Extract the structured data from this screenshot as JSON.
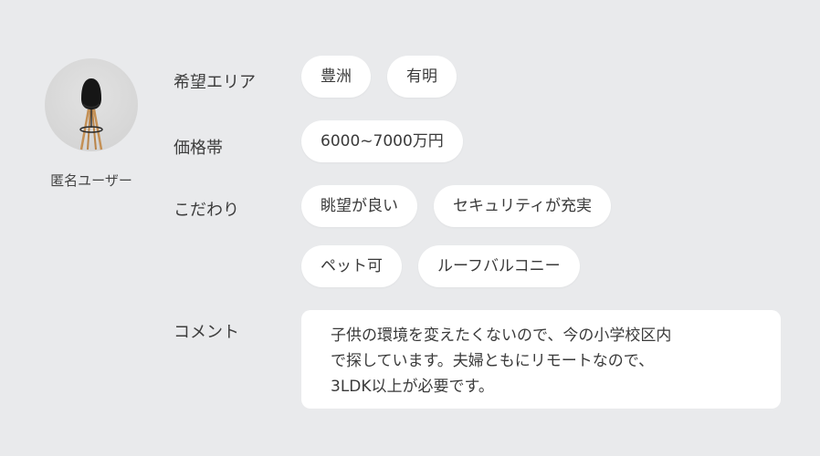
{
  "profile": {
    "avatar_icon": "chair-photo",
    "username": "匿名ユーザー"
  },
  "preferences": {
    "area": {
      "label": "希望エリア",
      "chips": [
        "豊洲",
        "有明"
      ]
    },
    "price": {
      "label": "価格帯",
      "chips": [
        "6000~7000万円"
      ]
    },
    "priorities": {
      "label": "こだわり",
      "chips_row1": [
        "眺望が良い",
        "セキュリティが充実"
      ],
      "chips_row2": [
        "ペット可",
        "ルーフバルコニー"
      ]
    },
    "comment": {
      "label": "コメント",
      "lines": [
        "子供の環境を変えたくないので、今の小学校区内",
        "で探しています。夫婦ともにリモートなので、",
        "3LDK以上が必要です。"
      ]
    }
  }
}
